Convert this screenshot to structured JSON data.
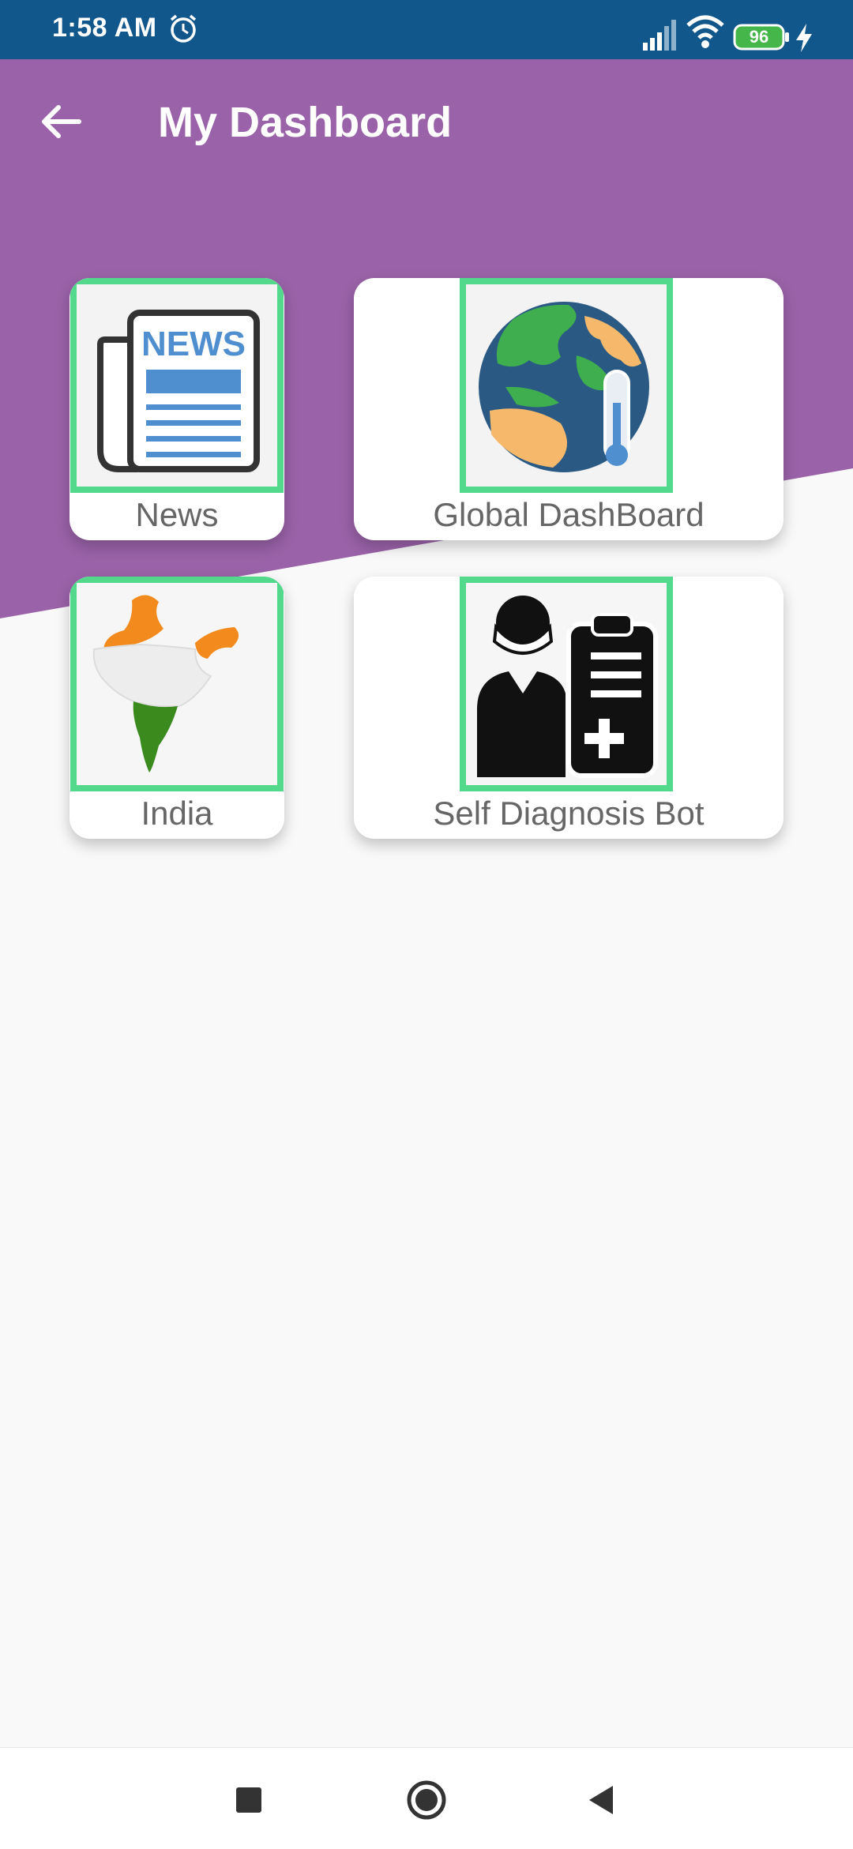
{
  "status_bar": {
    "time": "1:58 AM",
    "battery_level": "96",
    "icons": [
      "alarm-icon",
      "signal-icon",
      "wifi-icon",
      "battery-icon",
      "charging-bolt-icon"
    ]
  },
  "header": {
    "title": "My Dashboard",
    "back_icon": "arrow-left-icon"
  },
  "tiles": [
    {
      "label": "News",
      "icon": "newspaper-icon"
    },
    {
      "label": "Global DashBoard",
      "icon": "globe-thermometer-icon"
    },
    {
      "label": "India",
      "icon": "india-map-icon"
    },
    {
      "label": "Self Diagnosis Bot",
      "icon": "doctor-clipboard-icon"
    }
  ],
  "colors": {
    "status_bar": "#11578b",
    "header": "#9a62a8",
    "tile_border": "#52d98b",
    "background": "#f9f9f9"
  },
  "nav": {
    "icons": [
      "recent-apps-icon",
      "home-icon",
      "back-triangle-icon"
    ]
  }
}
